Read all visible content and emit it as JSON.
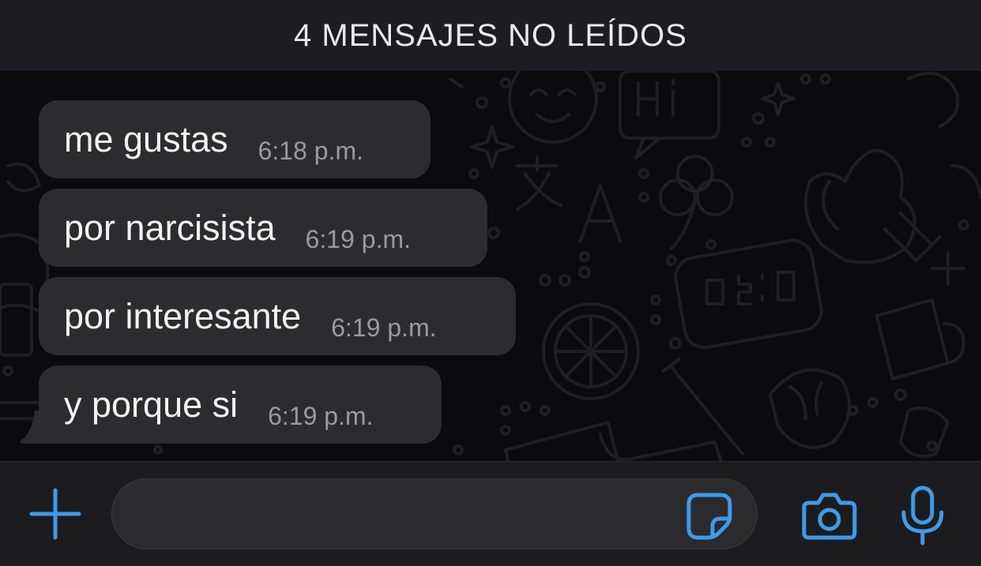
{
  "banner": {
    "unread_label": "4 MENSAJES NO LEÍDOS"
  },
  "messages": [
    {
      "text": "me gustas",
      "time": "6:18 p.m."
    },
    {
      "text": "por narcisista",
      "time": "6:19 p.m."
    },
    {
      "text": "por interesante",
      "time": "6:19 p.m."
    },
    {
      "text": "y porque si",
      "time": "6:19 p.m."
    }
  ],
  "composer": {
    "placeholder": "",
    "icons": {
      "plus": "plus-icon",
      "sticker": "sticker-icon",
      "camera": "camera-icon",
      "mic": "microphone-icon"
    }
  },
  "colors": {
    "accent": "#3d9be9",
    "bubble": "#2c2c2f",
    "background": "#0b0b0d",
    "banner": "#1d1d21"
  }
}
